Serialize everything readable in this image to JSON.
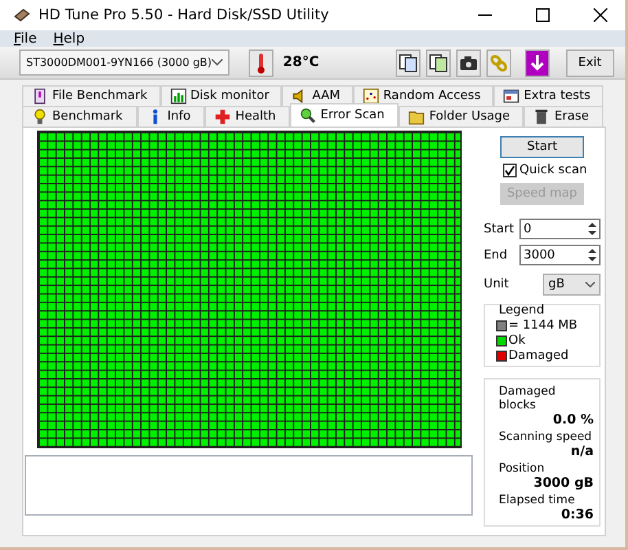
{
  "window": {
    "title": "HD Tune Pro 5.50 - Hard Disk/SSD Utility"
  },
  "menu": [
    {
      "label": "File"
    },
    {
      "label": "Help"
    }
  ],
  "toolbar": {
    "drive": "ST3000DM001-9YN166 (3000 gB)",
    "temperature": "28°C",
    "exit": "Exit"
  },
  "tab_rows": [
    [
      {
        "label": "File Benchmark",
        "selected": false
      },
      {
        "label": "Disk monitor",
        "selected": false
      },
      {
        "label": "AAM",
        "selected": false
      },
      {
        "label": "Random Access",
        "selected": false
      },
      {
        "label": "Extra tests",
        "selected": false
      }
    ],
    [
      {
        "label": "Benchmark",
        "selected": false
      },
      {
        "label": "Info",
        "selected": false
      },
      {
        "label": "Health",
        "selected": false
      },
      {
        "label": "Error Scan",
        "selected": true
      },
      {
        "label": "Folder Usage",
        "selected": false
      },
      {
        "label": "Erase",
        "selected": false
      }
    ]
  ],
  "controls": {
    "start_button": "Start",
    "quick_scan": {
      "label": "Quick scan",
      "checked": true
    },
    "speed_map": {
      "label": "Speed map",
      "disabled": true
    },
    "start": {
      "label": "Start",
      "value": "0"
    },
    "end": {
      "label": "End",
      "value": "3000"
    },
    "unit": {
      "label": "Unit",
      "value": "gB"
    }
  },
  "legend": {
    "title": "Legend",
    "items": [
      {
        "label": "= 1144 MB",
        "color": "#808080"
      },
      {
        "label": "Ok",
        "color": "#00d800"
      },
      {
        "label": "Damaged",
        "color": "#e00000"
      }
    ]
  },
  "stats": [
    {
      "label": "Damaged blocks",
      "value": "0.0 %"
    },
    {
      "label": "Scanning speed",
      "value": "n/a"
    },
    {
      "label": "Position",
      "value": "3000 gB"
    },
    {
      "label": "Elapsed time",
      "value": "0:36"
    }
  ]
}
